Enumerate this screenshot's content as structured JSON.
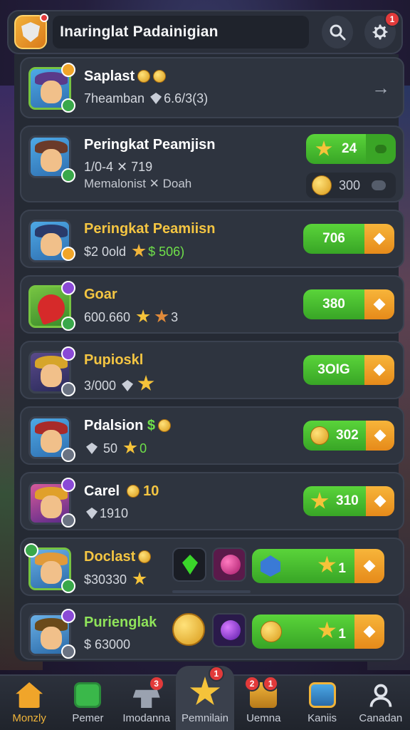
{
  "header": {
    "title": "Inaringlat Padainigian",
    "settings_badge": "1"
  },
  "rows": [
    {
      "name": "Saplast",
      "sub": "7heamban",
      "sub_value": "6.6/3(3)",
      "variant": "chevron"
    },
    {
      "name": "Peringkat Peamjisn",
      "sub": "1/0-4 ✕ 719",
      "sub2": "Memalonist ✕ Doah",
      "action_value": "24",
      "secondary_value": "300",
      "variant": "toggle"
    },
    {
      "name": "Peringkat Peamiisn",
      "sub": "$2 0old",
      "sub_value": "$ 506)",
      "action_value": "706",
      "variant": "action",
      "name_color": "gold"
    },
    {
      "name": "Goar",
      "sub": "600.660",
      "sub_value": "3",
      "action_value": "380",
      "variant": "action",
      "name_color": "gold"
    },
    {
      "name": "Pupioskl",
      "sub": "3/000",
      "action_value": "3OIG",
      "variant": "action",
      "name_color": "gold"
    },
    {
      "name": "Pdalsion",
      "sub": "50",
      "sub_value": "0",
      "action_value": "302",
      "variant": "coin-action"
    },
    {
      "name": "Carel",
      "name_suffix": "10",
      "sub": "1910",
      "action_value": "310",
      "variant": "coin-action"
    },
    {
      "name": "Doclast",
      "sub": "$30330",
      "action_value": "1",
      "variant": "items",
      "name_color": "gold"
    },
    {
      "name": "Purienglak",
      "sub": "$ 63000",
      "action_value": "1",
      "variant": "items2",
      "name_color": "green"
    }
  ],
  "nav": [
    {
      "label": "Monzly",
      "icon": "home-icon",
      "active": false,
      "badge": ""
    },
    {
      "label": "Pemer",
      "icon": "calendar-icon",
      "active": false,
      "badge": ""
    },
    {
      "label": "Imodanna",
      "icon": "anvil-icon",
      "active": false,
      "badge": "3"
    },
    {
      "label": "Pemnilain",
      "icon": "trophy-star-icon",
      "active": true,
      "badge": "1"
    },
    {
      "label": "Uemna",
      "icon": "chest-icon",
      "active": false,
      "badge": "1"
    },
    {
      "label": "Kaniis",
      "icon": "treasure-icon",
      "active": false,
      "badge": ""
    },
    {
      "label": "Canadan",
      "icon": "profile-icon",
      "active": false,
      "badge": ""
    }
  ],
  "colors": {
    "accent_green": "#5ad43a",
    "accent_orange": "#f7b53a",
    "gold_text": "#f4c542",
    "badge_red": "#e23a3a"
  }
}
